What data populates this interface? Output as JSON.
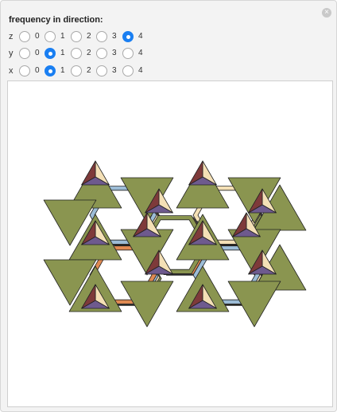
{
  "controls": {
    "heading": "frequency in direction:",
    "close_glyph": "×",
    "rows": [
      {
        "axis": "z",
        "selected": 4,
        "options": [
          "0",
          "1",
          "2",
          "3",
          "4"
        ]
      },
      {
        "axis": "y",
        "selected": 1,
        "options": [
          "0",
          "1",
          "2",
          "3",
          "4"
        ]
      },
      {
        "axis": "x",
        "selected": 1,
        "options": [
          "0",
          "1",
          "2",
          "3",
          "4"
        ]
      }
    ]
  },
  "colors": {
    "accent": "#1a7ff2",
    "olive": "#8a9550",
    "maroon": "#7e3a3a",
    "purple": "#6e5a8e",
    "cream": "#f4e0b6",
    "blue": "#9cbcd6",
    "orange": "#e08a52"
  }
}
